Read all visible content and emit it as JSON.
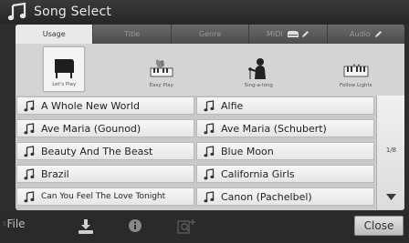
{
  "title": "Song Select",
  "tabs": [
    {
      "label": "Usage",
      "active": true
    },
    {
      "label": "Title",
      "active": false
    },
    {
      "label": "Genre",
      "active": false
    },
    {
      "label": "MIDI",
      "active": false
    },
    {
      "label": "Audio",
      "active": false
    }
  ],
  "categories": [
    {
      "label": "Let's Play",
      "icon": "grand-piano-icon",
      "selected": true
    },
    {
      "label": "Easy Play",
      "icon": "hand-on-keys-icon",
      "selected": false
    },
    {
      "label": "Sing-a-long",
      "icon": "singer-microphone-icon",
      "selected": false
    },
    {
      "label": "Follow Lights",
      "icon": "keyboard-lights-icon",
      "selected": false
    }
  ],
  "songs": {
    "left": [
      "A Whole New World",
      "Ave Maria (Gounod)",
      "Beauty And The Beast",
      "Brazil",
      "Can You Feel The Love Tonight"
    ],
    "right": [
      "Alfie",
      "Ave Maria (Schubert)",
      "Blue Moon",
      "California Girls",
      "Canon (Pachelbel)"
    ]
  },
  "pagination": {
    "label": "1/8"
  },
  "bottom": {
    "file_label": "File",
    "close_label": "Close"
  },
  "colors": {
    "title_bg": "#2d2d2d",
    "panel_bg": "#cfcfcf",
    "row_bg": "#eeeeee",
    "tab_active": "#e9e9e9"
  }
}
